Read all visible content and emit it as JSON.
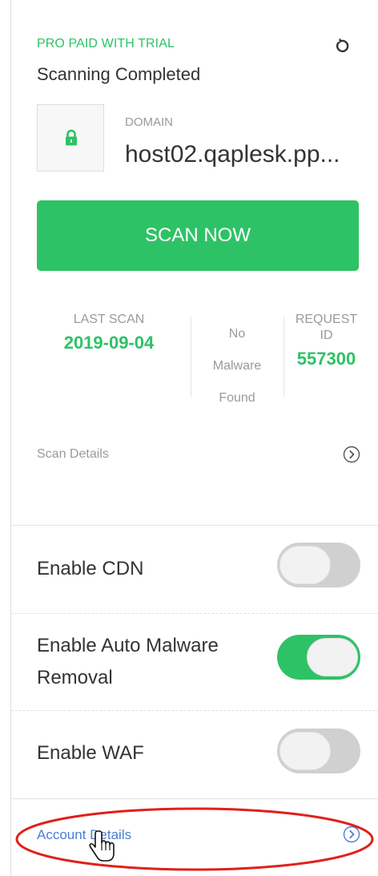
{
  "header": {
    "plan_label": "PRO PAID WITH TRIAL",
    "status": "Scanning Completed",
    "refresh_icon": "refresh-icon"
  },
  "domain": {
    "caption": "DOMAIN",
    "value": "host02.qaplesk.pp...",
    "icon": "lock-icon"
  },
  "scan_button": {
    "label": "SCAN NOW"
  },
  "stats": {
    "last_scan_caption": "LAST SCAN",
    "last_scan_value": "2019-09-04",
    "malware_line1": "No",
    "malware_line2": "Malware",
    "malware_line3": "Found",
    "request_caption_line1": "REQUEST",
    "request_caption_line2": "ID",
    "request_value": "557300"
  },
  "scan_details": {
    "label": "Scan Details",
    "icon": "chevron-right-circle-icon"
  },
  "settings": [
    {
      "label": "Enable CDN",
      "enabled": false
    },
    {
      "label_line1": "Enable Auto Malware",
      "label_line2": "Removal",
      "enabled": true
    },
    {
      "label": "Enable WAF",
      "enabled": false
    }
  ],
  "account_details": {
    "label": "Account Details",
    "icon": "chevron-right-circle-icon"
  },
  "colors": {
    "accent_green": "#2ec266",
    "link_blue": "#4a7fd0",
    "muted_text": "#9a9a9a",
    "annotation_red": "#e0201a"
  }
}
